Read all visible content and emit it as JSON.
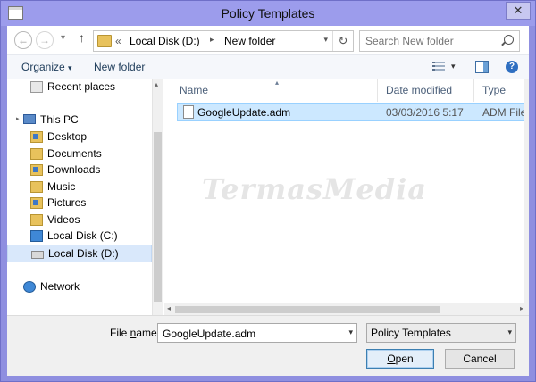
{
  "window": {
    "title": "Policy Templates",
    "close_glyph": "✕"
  },
  "nav": {
    "back_glyph": "←",
    "forward_glyph": "→",
    "recent_glyph": "▾",
    "up_glyph": "↑",
    "address_prefix": "«",
    "address_segments": [
      "Local Disk (D:)",
      "New folder"
    ],
    "address_sep": "▸",
    "refresh_glyph": "↻",
    "search_placeholder": "Search New folder"
  },
  "toolbar": {
    "organize_label": "Organize",
    "organize_caret": "▾",
    "new_folder_label": "New folder",
    "help_glyph": "?"
  },
  "sidebar": {
    "items": [
      {
        "label": "Recent places",
        "icon": "recent-places-icon"
      },
      {
        "label": "This PC",
        "icon": "computer-icon"
      },
      {
        "label": "Desktop",
        "icon": "folder-icon"
      },
      {
        "label": "Documents",
        "icon": "folder-icon"
      },
      {
        "label": "Downloads",
        "icon": "folder-icon"
      },
      {
        "label": "Music",
        "icon": "folder-icon"
      },
      {
        "label": "Pictures",
        "icon": "folder-icon"
      },
      {
        "label": "Videos",
        "icon": "folder-icon"
      },
      {
        "label": "Local Disk (C:)",
        "icon": "drive-icon"
      },
      {
        "label": "Local Disk (D:)",
        "icon": "drive-icon",
        "selected": true
      },
      {
        "label": "Network",
        "icon": "network-icon"
      }
    ],
    "expander_glyph": "▸"
  },
  "files": {
    "columns": [
      "Name",
      "Date modified",
      "Type"
    ],
    "sort_glyph": "▴",
    "rows": [
      {
        "name": "GoogleUpdate.adm",
        "date": "03/03/2016 5:17",
        "type": "ADM File"
      }
    ]
  },
  "watermark": "TermasMedia",
  "bottom": {
    "file_name_label_pre": "File ",
    "file_name_label_u": "n",
    "file_name_label_post": "ame:",
    "file_name_value": "GoogleUpdate.adm",
    "file_type_value": "Policy Templates",
    "open_label_u": "O",
    "open_label_rest": "pen",
    "cancel_label": "Cancel",
    "caret_glyph": "▾"
  },
  "colors": {
    "titlebar": "#9c9cec",
    "selection": "#cce8ff",
    "accent": "#3c7fb1"
  }
}
